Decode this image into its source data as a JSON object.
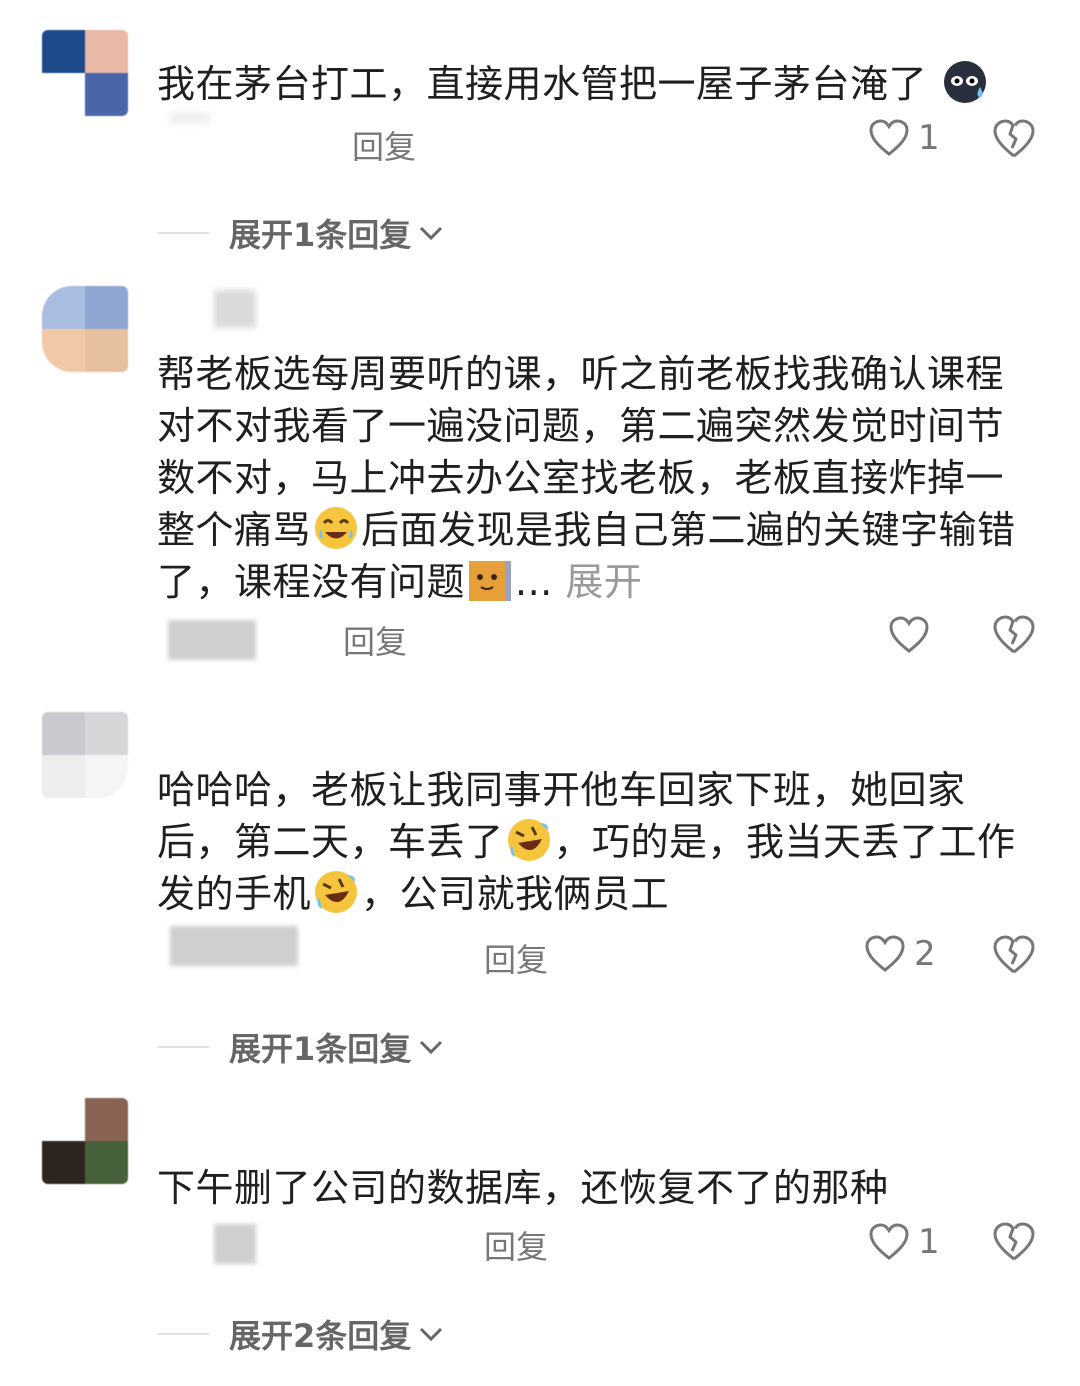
{
  "comments": [
    {
      "text": "我在茅台打工，直接用水管把一屋子茅台淹了",
      "reply_label": "回复",
      "likes": "1",
      "avatar_colors": [
        "#1e4a8c",
        "#e8b9a6",
        "#ffffff",
        "#4a66a8"
      ],
      "expand_label": "展开1条回复"
    },
    {
      "text_parts": [
        "帮老板选每周要听的课，听之前老板找我确认课程对不对我看了一遍没问题，第二遍突然发觉时间节数不对，马上冲去办公室找老板，老板直接炸掉一整个痛骂",
        "后面发现是我自己第二遍的关键字输错了，课程没有问题",
        "..."
      ],
      "more_label": "展开",
      "reply_label": "回复",
      "likes": "",
      "avatar_colors": [
        "#a9bde0",
        "#8fa6d0",
        "#f2c9a8",
        "#e7c0a0"
      ]
    },
    {
      "text_parts": [
        "哈哈哈，老板让我同事开他车回家下班，她回家后，第二天，车丢了",
        "，巧的是，我当天丢了工作发的手机",
        "，公司就我俩员工"
      ],
      "reply_label": "回复",
      "likes": "2",
      "avatar_colors": [
        "#c9c9cf",
        "#d6d6d9",
        "#ededee",
        "#f5f5f5"
      ],
      "expand_label": "展开1条回复"
    },
    {
      "text": "下午删了公司的数据库，还恢复不了的那种",
      "reply_label": "回复",
      "likes": "1",
      "avatar_colors": [
        "#ffffff",
        "#8a6355",
        "#2f2520",
        "#46613c"
      ],
      "expand_label": "展开2条回复"
    }
  ],
  "icons": {
    "heart": "heart-icon",
    "dislike": "broken-heart-icon",
    "chevron": "chevron-down-icon"
  },
  "colors": {
    "text": "#1f1f1f",
    "secondary": "#777777",
    "expand": "#666666"
  }
}
